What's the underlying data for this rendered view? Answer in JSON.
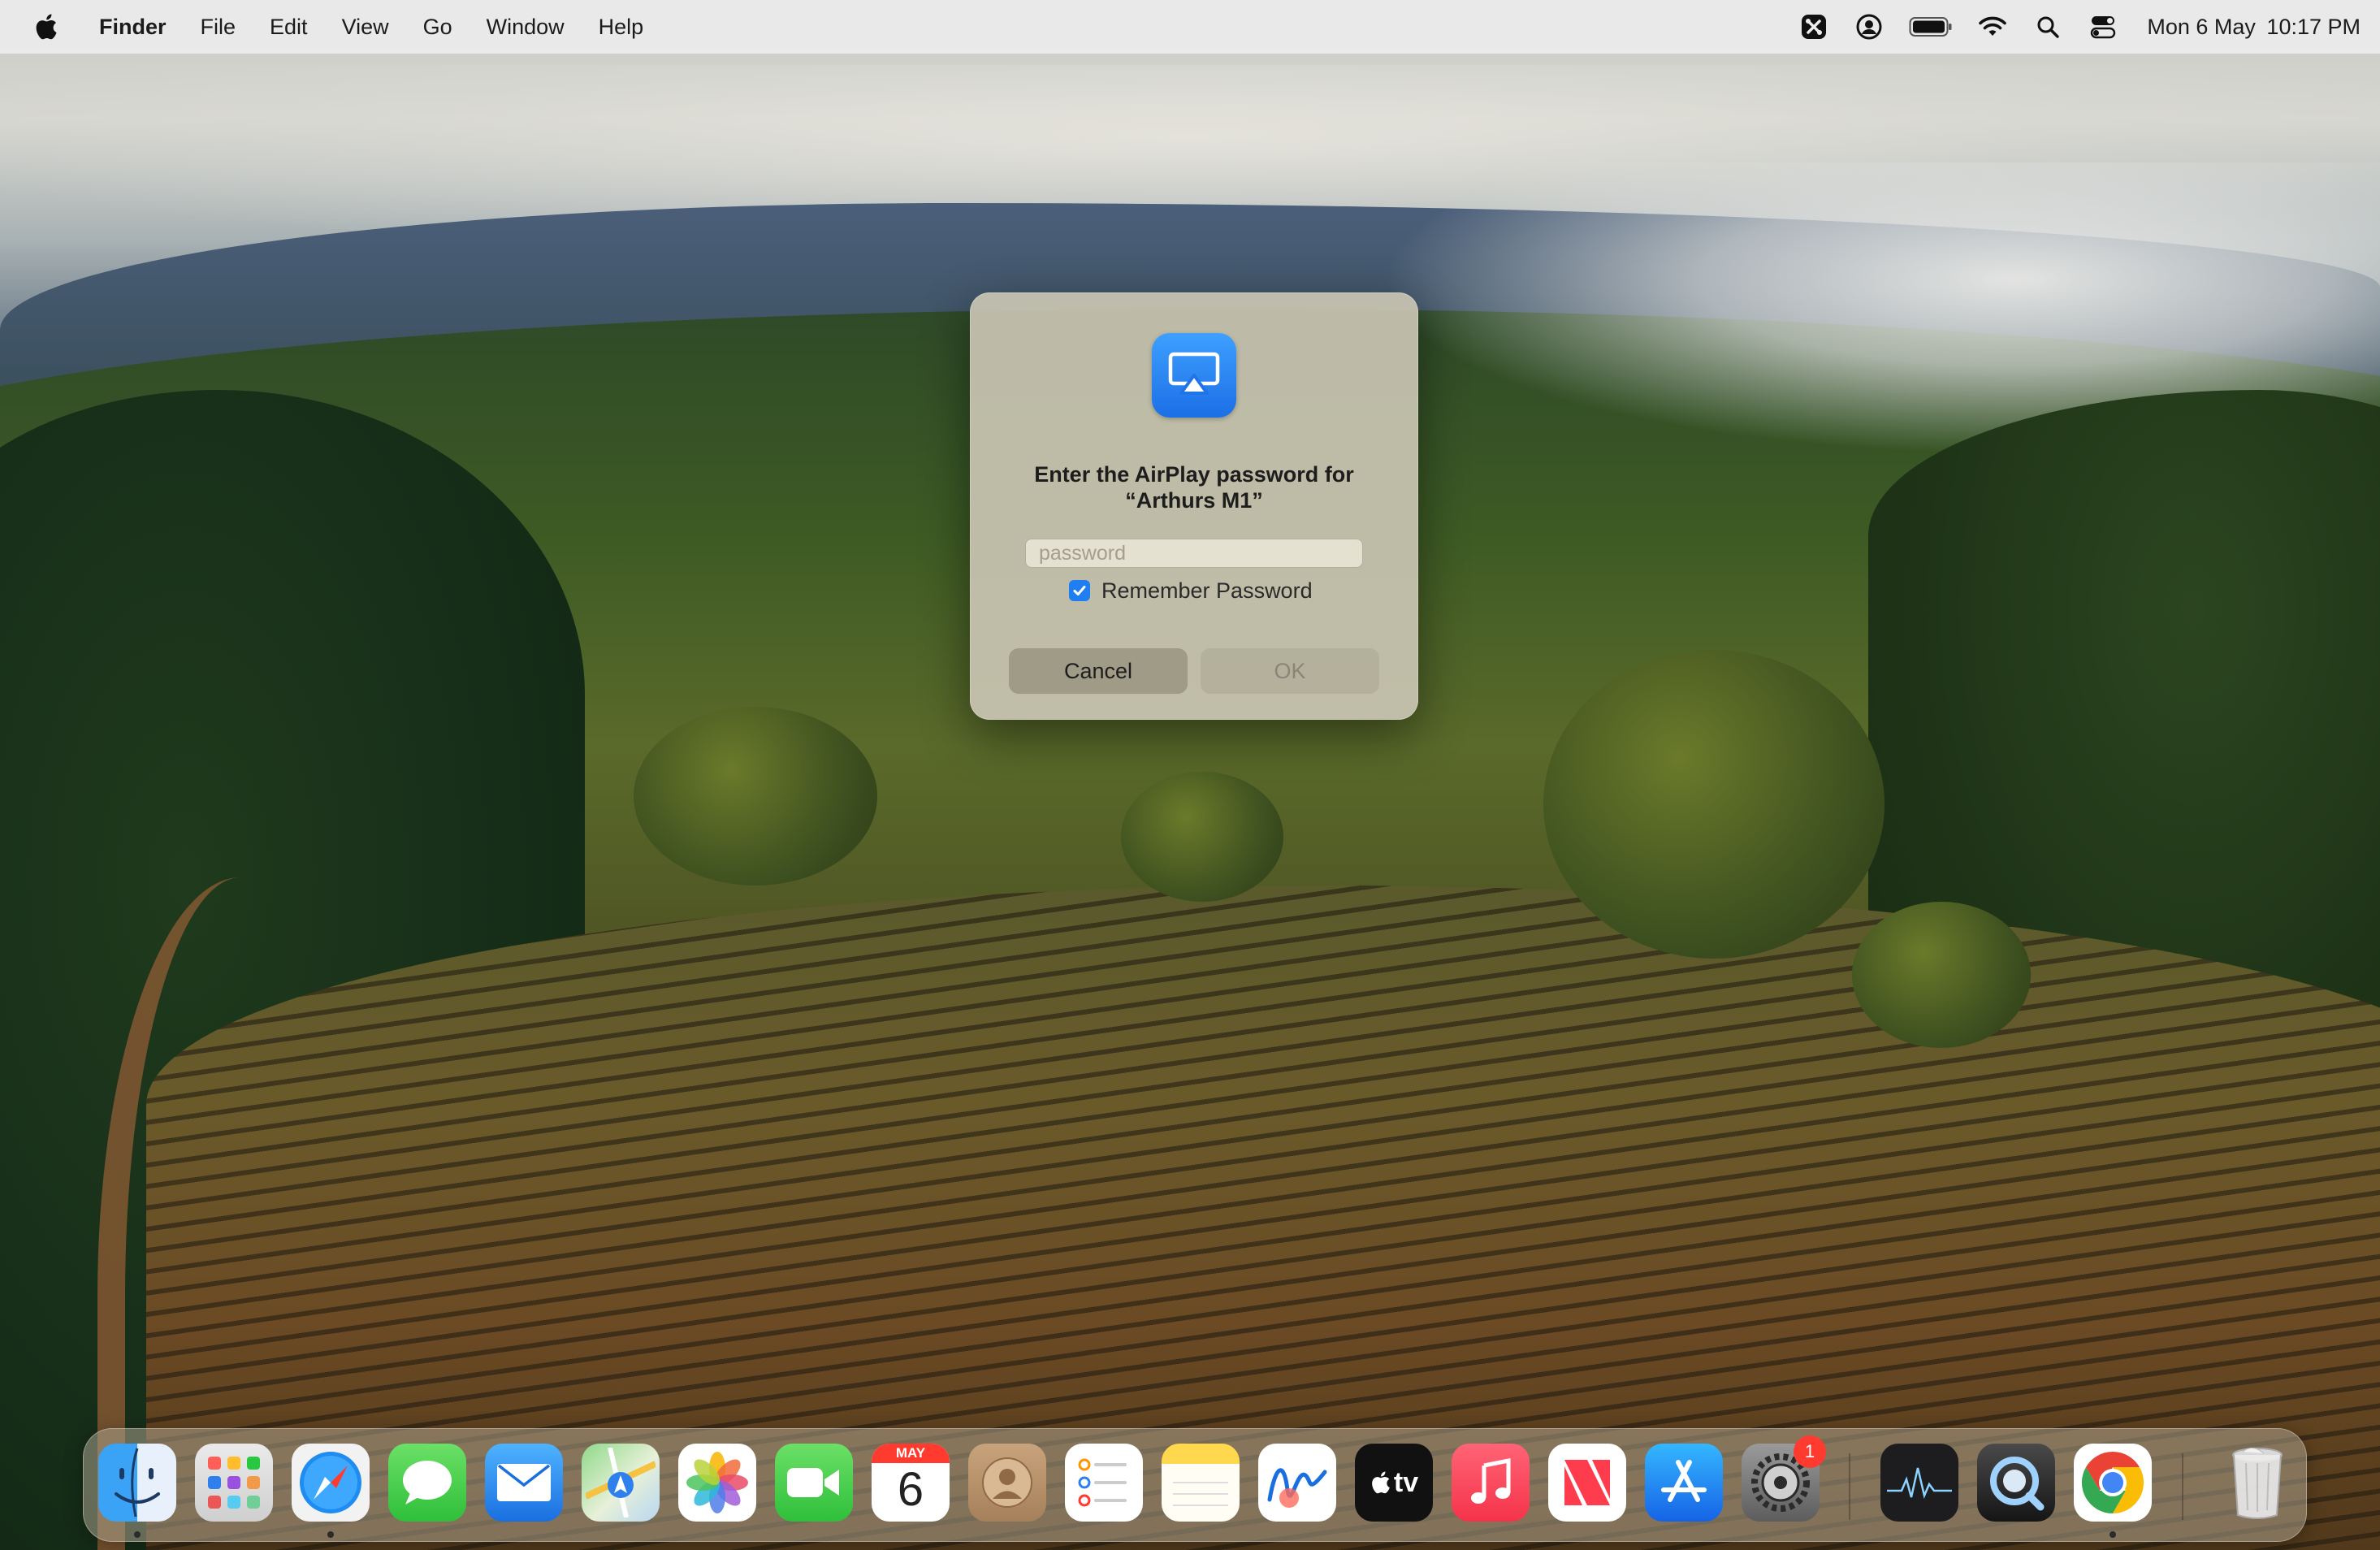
{
  "menubar": {
    "apple_icon": "apple-logo-icon",
    "items": [
      "Finder",
      "File",
      "Edit",
      "View",
      "Go",
      "Window",
      "Help"
    ],
    "status_icons": [
      "shortcut-app-icon",
      "user-account-icon",
      "battery-icon",
      "wifi-icon",
      "spotlight-search-icon",
      "control-center-icon"
    ],
    "date": "Mon 6 May",
    "time": "10:17 PM"
  },
  "dialog": {
    "icon": "airplay-icon",
    "title_line1": "Enter the AirPlay password for",
    "title_line2": "“Arthurs M1”",
    "password_placeholder": "password",
    "password_value": "",
    "remember_label": "Remember Password",
    "remember_checked": true,
    "cancel_label": "Cancel",
    "ok_label": "OK"
  },
  "dock": {
    "items": [
      {
        "name": "Finder",
        "icon": "finder-icon",
        "running": true
      },
      {
        "name": "Launchpad",
        "icon": "launchpad-icon",
        "running": false
      },
      {
        "name": "Safari",
        "icon": "safari-icon",
        "running": true
      },
      {
        "name": "Messages",
        "icon": "messages-icon",
        "running": false
      },
      {
        "name": "Mail",
        "icon": "mail-icon",
        "running": false
      },
      {
        "name": "Maps",
        "icon": "maps-icon",
        "running": false
      },
      {
        "name": "Photos",
        "icon": "photos-icon",
        "running": false
      },
      {
        "name": "FaceTime",
        "icon": "facetime-icon",
        "running": false
      },
      {
        "name": "Calendar",
        "icon": "calendar-icon",
        "running": false,
        "month": "MAY",
        "day": "6"
      },
      {
        "name": "Contacts",
        "icon": "contacts-icon",
        "running": false
      },
      {
        "name": "Reminders",
        "icon": "reminders-icon",
        "running": false
      },
      {
        "name": "Notes",
        "icon": "notes-icon",
        "running": false
      },
      {
        "name": "Freeform",
        "icon": "freeform-icon",
        "running": false
      },
      {
        "name": "TV",
        "icon": "apple-tv-icon",
        "running": false,
        "label": "tv"
      },
      {
        "name": "Music",
        "icon": "music-icon",
        "running": false
      },
      {
        "name": "News",
        "icon": "news-icon",
        "running": false
      },
      {
        "name": "App Store",
        "icon": "app-store-icon",
        "running": false
      },
      {
        "name": "System Settings",
        "icon": "system-settings-icon",
        "running": false,
        "badge": "1"
      },
      {
        "name": "Activity Monitor",
        "icon": "activity-monitor-icon",
        "running": false
      },
      {
        "name": "QuickTime Player",
        "icon": "quicktime-icon",
        "running": false
      },
      {
        "name": "Google Chrome",
        "icon": "chrome-icon",
        "running": true
      },
      {
        "name": "Trash",
        "icon": "trash-icon",
        "running": false
      }
    ]
  },
  "colors": {
    "accent": "#1f7ef1",
    "badge": "#ff3b30"
  }
}
